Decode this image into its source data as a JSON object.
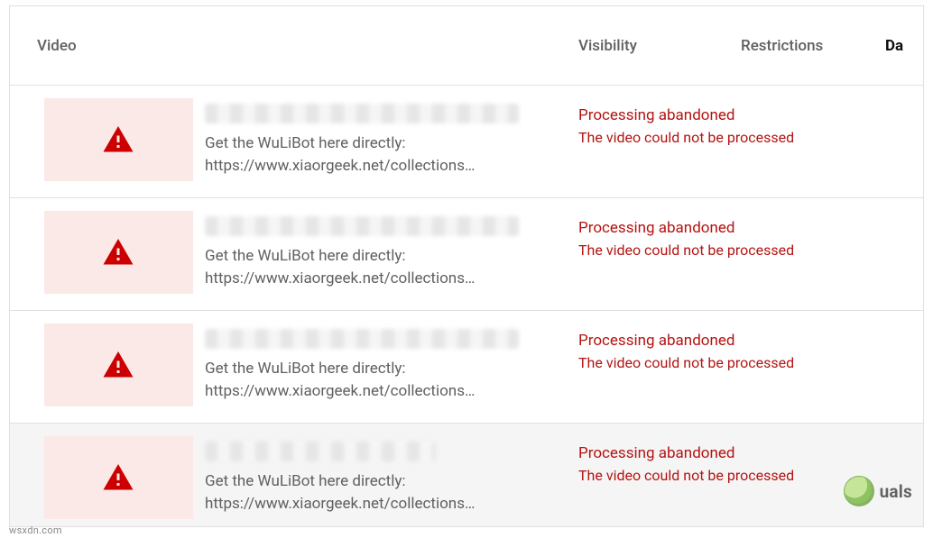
{
  "header": {
    "video": "Video",
    "visibility": "Visibility",
    "restrictions": "Restrictions",
    "date": "Da"
  },
  "status": {
    "title": "Processing abandoned",
    "sub": "The video could not be processed"
  },
  "rows": [
    {
      "desc1": "Get the WuLiBot here directly:",
      "desc2": "https://www.xiaorgeek.net/collections…",
      "highlight": false
    },
    {
      "desc1": "Get the WuLiBot here directly:",
      "desc2": "https://www.xiaorgeek.net/collections…",
      "highlight": false
    },
    {
      "desc1": "Get the WuLiBot here directly:",
      "desc2": "https://www.xiaorgeek.net/collections…",
      "highlight": false
    },
    {
      "desc1": "Get the WuLiBot here directly:",
      "desc2": "https://www.xiaorgeek.net/collections…",
      "highlight": true
    }
  ],
  "watermark": {
    "text": "uals"
  },
  "source": "wsxdn.com"
}
